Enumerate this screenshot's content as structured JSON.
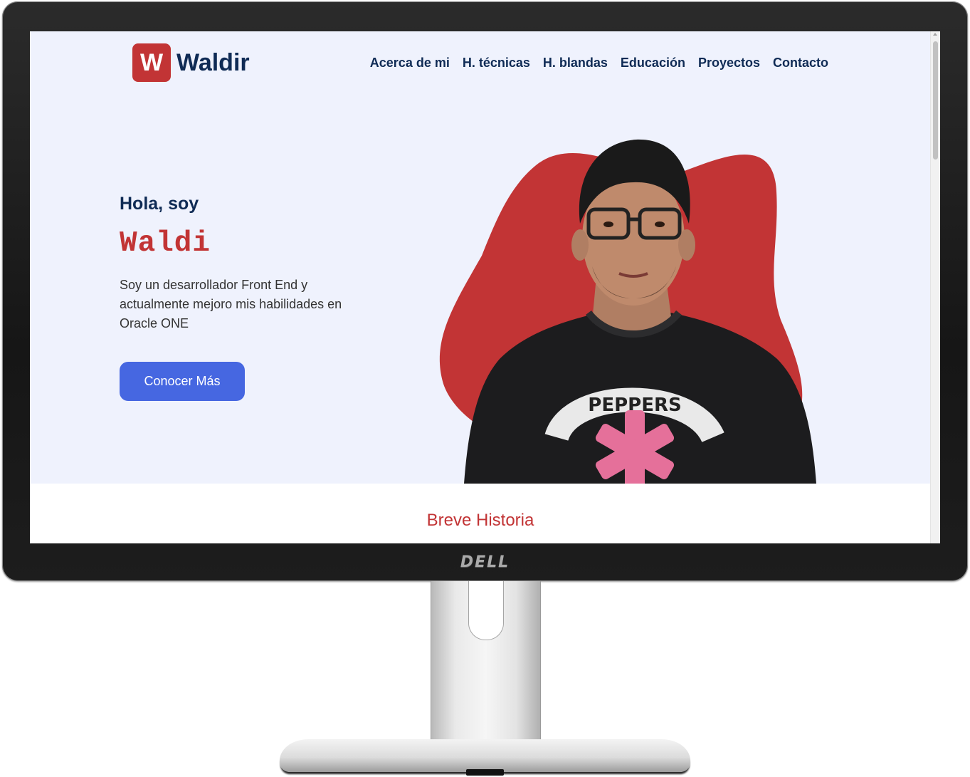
{
  "device": {
    "brand": "DELL"
  },
  "header": {
    "logo_letter": "W",
    "logo_text": "Waldir",
    "nav": [
      {
        "label": "Acerca de mi"
      },
      {
        "label": "H. técnicas"
      },
      {
        "label": "H. blandas"
      },
      {
        "label": "Educación"
      },
      {
        "label": "Proyectos"
      },
      {
        "label": "Contacto"
      }
    ]
  },
  "hero": {
    "greeting": "Hola, soy",
    "name": "Waldi",
    "description": "Soy un desarrollador Front End y actualmente mejoro mis habilidades en Oracle ONE",
    "cta_label": "Conocer Más",
    "accent_color": "#c23435",
    "button_color": "#4667e1",
    "shirt_text": "PEPPERS"
  },
  "history": {
    "title": "Breve Historia"
  }
}
